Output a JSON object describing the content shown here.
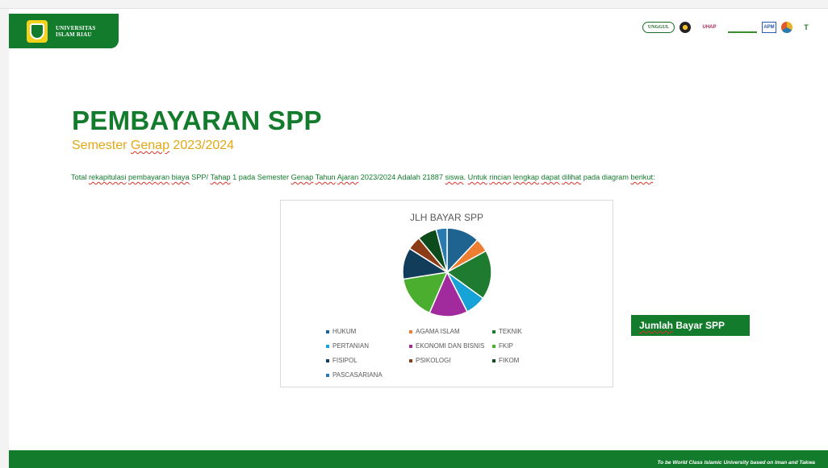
{
  "brand": {
    "line1": "UNIVERSITAS",
    "line2": "ISLAM RIAU"
  },
  "partner_logos": [
    {
      "name": "unggul-logo",
      "text": "UNGGUL"
    },
    {
      "name": "flower-logo",
      "text": ""
    },
    {
      "name": "uhap-logo",
      "text": "UHAP"
    },
    {
      "name": "bar-logo",
      "text": ""
    },
    {
      "name": "apm-logo",
      "text": "APM"
    },
    {
      "name": "circle-logo",
      "text": ""
    },
    {
      "name": "t-logo",
      "text": "T"
    }
  ],
  "title": "PEMBAYARAN SPP",
  "subtitle": {
    "pre": "Semester ",
    "word": "Genap",
    "post": " 2023/2024"
  },
  "body": [
    {
      "t": "Total ",
      "w": false
    },
    {
      "t": "rekapitulasi",
      "w": true
    },
    {
      "t": " ",
      "w": false
    },
    {
      "t": "pembayaran",
      "w": true
    },
    {
      "t": " ",
      "w": false
    },
    {
      "t": "biaya",
      "w": true
    },
    {
      "t": " SPP/ ",
      "w": false
    },
    {
      "t": "Tahap",
      "w": true
    },
    {
      "t": " 1 pada Semester ",
      "w": false
    },
    {
      "t": "Genap",
      "w": true
    },
    {
      "t": " ",
      "w": false
    },
    {
      "t": "Tahun",
      "w": true
    },
    {
      "t": " ",
      "w": false
    },
    {
      "t": "Ajaran",
      "w": true
    },
    {
      "t": " 2023/2024 Adalah 21887 ",
      "w": false
    },
    {
      "t": "siswa",
      "w": true
    },
    {
      "t": ". ",
      "w": false
    },
    {
      "t": "Untuk",
      "w": true
    },
    {
      "t": " ",
      "w": false
    },
    {
      "t": "rincian",
      "w": true
    },
    {
      "t": " ",
      "w": false
    },
    {
      "t": "lengkap",
      "w": true
    },
    {
      "t": " ",
      "w": false
    },
    {
      "t": "dapat",
      "w": true
    },
    {
      "t": " ",
      "w": false
    },
    {
      "t": "dilihat",
      "w": true
    },
    {
      "t": " pada diagram ",
      "w": false
    },
    {
      "t": "berikut",
      "w": true
    },
    {
      "t": ":",
      "w": false
    }
  ],
  "chart_data": {
    "type": "pie",
    "title": "JLH BAYAR SPP",
    "legend_position": "bottom",
    "categories": [
      "HUKUM",
      "AGAMA ISLAM",
      "TEKNIK",
      "PERTANIAN",
      "EKONOMI DAN BISNIS",
      "FKIP",
      "FISIPOL",
      "PSIKOLOGI",
      "FIKOM",
      "PASCASARIANA"
    ],
    "values": [
      12.0,
      5.0,
      18.0,
      7.5,
      14.0,
      16.0,
      11.5,
      5.0,
      7.0,
      4.0
    ],
    "colors": [
      "#1f6391",
      "#ed7d31",
      "#1e7b2f",
      "#17a2d8",
      "#a12b9c",
      "#4cae2f",
      "#123d5a",
      "#8b3c16",
      "#0d4a1c",
      "#2a7ab0"
    ]
  },
  "jumlah_label": {
    "word": "Jumlah",
    "rest": " Bayar SPP"
  },
  "footer": "To be World Class Islamic University based on Iman and Takwa"
}
